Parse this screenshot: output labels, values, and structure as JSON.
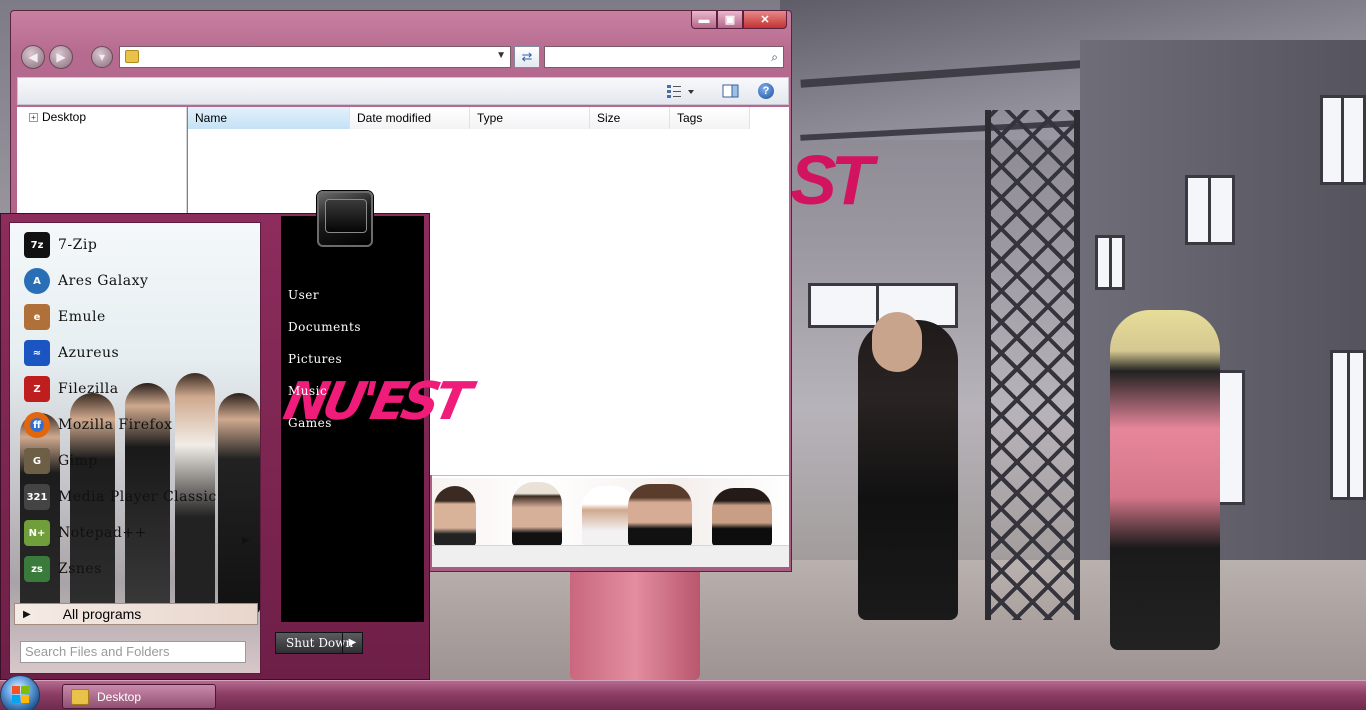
{
  "explorer": {
    "caption_buttons": {
      "minimize": "▬",
      "maximize": "▣",
      "close": "✕"
    },
    "address_value": "",
    "search_placeholder": "",
    "nav_tree": [
      {
        "label": "Desktop",
        "expander": "+"
      }
    ],
    "columns": [
      {
        "label": "Name"
      },
      {
        "label": "Date modified"
      },
      {
        "label": "Type"
      },
      {
        "label": "Size"
      },
      {
        "label": "Tags"
      }
    ],
    "icons": {
      "back": "back-arrow-icon",
      "forward": "forward-arrow-icon",
      "recent": "recent-pages-icon",
      "refresh": "refresh-icon",
      "search": "search-icon",
      "views": "views-icon",
      "preview": "preview-pane-icon",
      "help": "help-icon"
    },
    "help_glyph": "?"
  },
  "start_menu": {
    "programs": [
      {
        "label": "7-Zip",
        "icon": "7zip-icon",
        "badge": "7z",
        "color": "#111111"
      },
      {
        "label": "Ares Galaxy",
        "icon": "ares-icon",
        "badge": "A",
        "color": "#2a6fb5"
      },
      {
        "label": "Emule",
        "icon": "emule-icon",
        "badge": "e",
        "color": "#b0703a"
      },
      {
        "label": "Azureus",
        "icon": "azureus-icon",
        "badge": "≈",
        "color": "#1a55c2"
      },
      {
        "label": "Filezilla",
        "icon": "filezilla-icon",
        "badge": "Z",
        "color": "#bf1e1e"
      },
      {
        "label": "Mozilla Firefox",
        "icon": "firefox-icon",
        "badge": "ff",
        "color": "#e2660d"
      },
      {
        "label": "Gimp",
        "icon": "gimp-icon",
        "badge": "G",
        "color": "#6d5e46"
      },
      {
        "label": "Media Player Classic",
        "icon": "media-player-classic-icon",
        "badge": "321",
        "color": "#444444"
      },
      {
        "label": "Notepad++",
        "icon": "notepad-plus-plus-icon",
        "badge": "N+",
        "color": "#6f9e3a"
      },
      {
        "label": "Zsnes",
        "icon": "zsnes-icon",
        "badge": "zs",
        "color": "#3a7a3a"
      }
    ],
    "submenu_arrow": "▶",
    "all_programs": {
      "arrow": "▶",
      "label": "All programs"
    },
    "search_placeholder": "Search Files and Folders",
    "places": [
      "User",
      "Documents",
      "Pictures",
      "Music",
      "Games"
    ],
    "logo_text": "NU'EST",
    "shutdown": {
      "label": "Shut Down",
      "arrow": "▶"
    }
  },
  "taskbar": {
    "start_icon": "windows-orb-icon",
    "buttons": [
      {
        "label": "Desktop",
        "icon": "folder-icon"
      }
    ]
  },
  "colors": {
    "accent": "#8d2d5d",
    "logo_pink": "#f01c7a",
    "taskbar": "#8c3e65"
  }
}
